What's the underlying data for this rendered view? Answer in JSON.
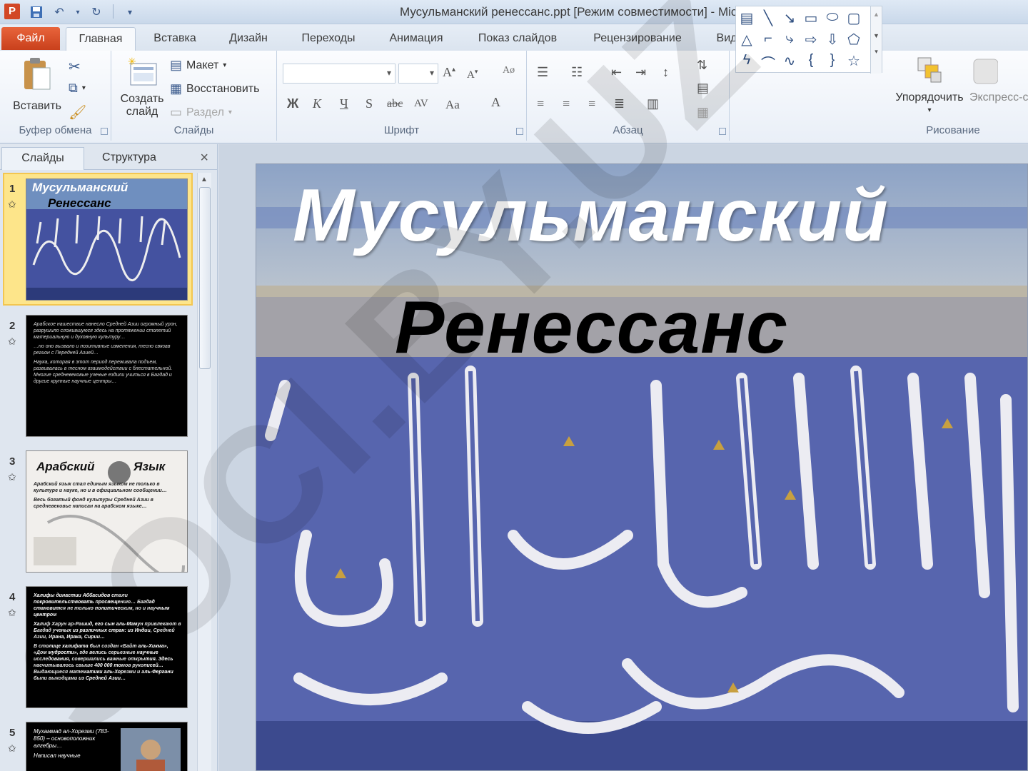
{
  "titlebar": {
    "app_icon": "P",
    "title": "Мусульманский ренессанс.ppt [Режим совместимости]  -  Microsoft PowerPoint"
  },
  "tabs": [
    {
      "label": "Файл"
    },
    {
      "label": "Главная"
    },
    {
      "label": "Вставка"
    },
    {
      "label": "Дизайн"
    },
    {
      "label": "Переходы"
    },
    {
      "label": "Анимация"
    },
    {
      "label": "Показ слайдов"
    },
    {
      "label": "Рецензирование"
    },
    {
      "label": "Вид"
    }
  ],
  "ribbon": {
    "clipboard": {
      "paste": "Вставить",
      "label": "Буфер обмена"
    },
    "slides": {
      "new_slide_1": "Создать",
      "new_slide_2": "слайд",
      "layout": "Макет",
      "reset": "Восстановить",
      "section": "Раздел",
      "label": "Слайды"
    },
    "font": {
      "label": "Шрифт",
      "bold": "Ж",
      "italic": "К",
      "underline": "Ч",
      "shadow": "S",
      "strike": "abc",
      "spacing": "AV",
      "case": "Aa",
      "color": "A"
    },
    "paragraph": {
      "label": "Абзац"
    },
    "drawing": {
      "arrange": "Упорядочить",
      "quick_styles": "Экспресс-с",
      "label": "Рисование"
    }
  },
  "left_pane": {
    "tab_slides": "Слайды",
    "tab_outline": "Структура",
    "close": "×",
    "thumbs": [
      {
        "num": "1",
        "title_1": "Мусульманский",
        "title_2": "Ренессанс"
      },
      {
        "num": "2",
        "bullets": [
          "Арабское нашествие нанесло Средней Азии огромный урон, разрушило сложившуюся здесь на протяжении столетий материальную и духовную культуру…",
          "…но оно вызвало и позитивные изменения, тесно связав регион с Передней Азией…",
          "Наука, которая в этот период переживала подъем, развивалась в тесном взаимодействии с блестательной. Многие средневековые ученые ездили учиться в Багдад и другие крупные научные центры…"
        ]
      },
      {
        "num": "3",
        "title_1": "Арабский",
        "title_2": "Язык",
        "bullets": [
          "Арабский язык стал единым языком не только в культуре и науке, но и в официальном сообщении…",
          "Весь богатый фонд культуры Средней Азии в средневековье написан на арабском языке…"
        ]
      },
      {
        "num": "4",
        "bullets": [
          "Халифы династии Аббасидов стали покровительствовать просвещению… Багдад становится не только политическим, но и научным центром",
          "Халиф Харун ар-Рашид, его сын аль-Мамун привлекают в Багдад ученых из различных стран: из Индии, Средней Азии, Ирана, Ирака, Сирии…",
          "В столице халифата был создан «Байт аль-Хикма», «Дом мудрости», где велись серьезные научные исследования, совершались важные открытия. Здесь насчитывалось свыше 400 000 томов рукописей… Выдающиеся математики аль-Хорезми и аль-Фергани были выходцами из Средней Азии…"
        ]
      },
      {
        "num": "5",
        "bullets": [
          "Мухаммад ал-Хорезми (783-850) – основоположник алгебры…",
          "Написал научные"
        ]
      }
    ]
  },
  "slide": {
    "title_line1": "Мусульманский",
    "title_line2": "Ренессанс"
  },
  "watermark": {
    "text": "SOCI.BY.UZ"
  },
  "colors": {
    "file_tab": "#d24726",
    "slide_calligraphy_bg": "#4f5da8",
    "selected_thumb": "#f3c650"
  }
}
